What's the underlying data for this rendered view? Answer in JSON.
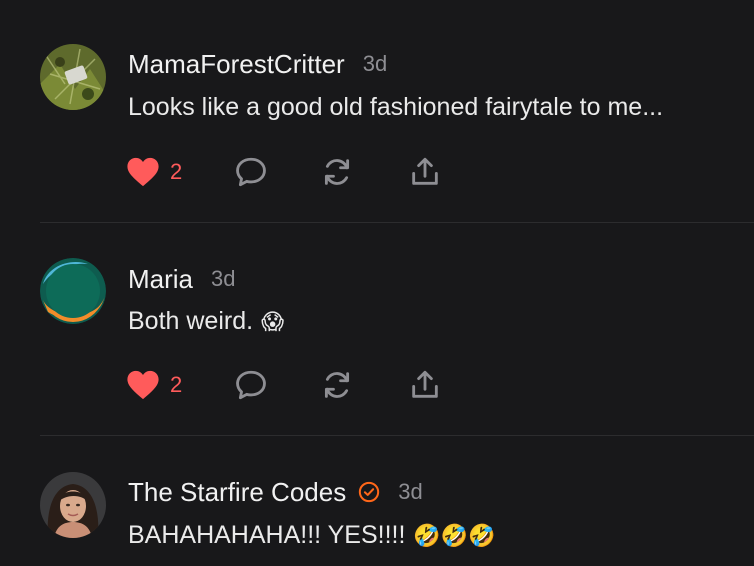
{
  "colors": {
    "background": "#18181a",
    "like_red": "#ff5b5b",
    "muted_gray": "#8e8e93",
    "verified_orange": "#ff6719",
    "divider": "#2c2c2e"
  },
  "comments": [
    {
      "username": "MamaForestCritter",
      "time": "3d",
      "text": "Looks like a good old fashioned fairytale to me...",
      "emoji": "",
      "likes": "2",
      "verified": false,
      "avatar": "nature-photo-avatar"
    },
    {
      "username": "Maria",
      "time": "3d",
      "text": "Both weird.",
      "emoji": "😱",
      "likes": "2",
      "verified": false,
      "avatar": "green-circle-avatar"
    },
    {
      "username": "The Starfire Codes",
      "time": "3d",
      "text": "BAHAHAHAHA!!! YES!!!!",
      "emoji": "🤣🤣🤣",
      "likes": "",
      "verified": true,
      "avatar": "portrait-photo-avatar"
    }
  ],
  "icons": {
    "like": "heart-icon",
    "reply": "comment-bubble-icon",
    "restack": "refresh-arrows-icon",
    "share": "share-upload-icon",
    "verified": "verified-check-icon"
  }
}
